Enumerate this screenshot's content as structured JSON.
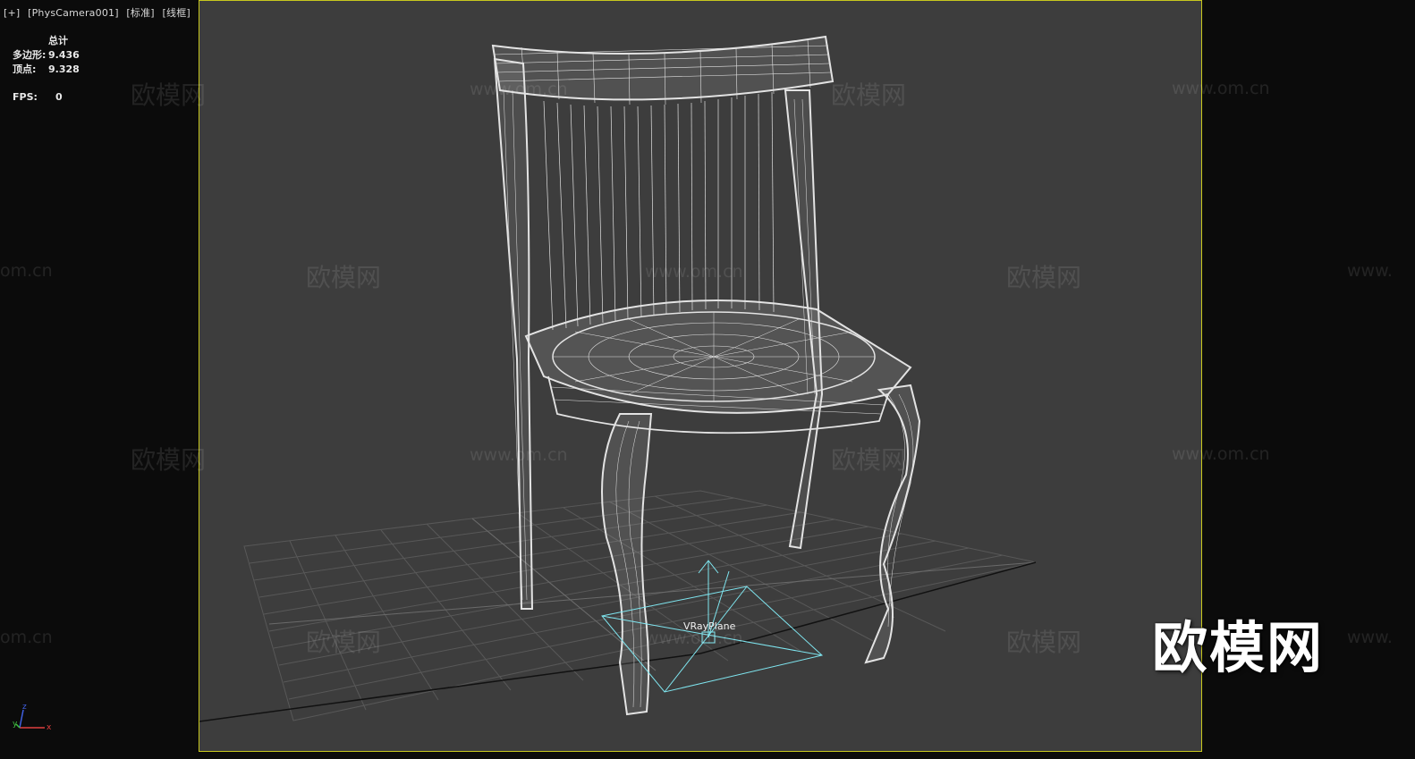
{
  "viewport": {
    "menu": "[+]",
    "camera": "[PhysCamera001]",
    "shading": "[标准]",
    "mode": "[线框]"
  },
  "stats": {
    "header": "总计",
    "polys_label": "多边形:",
    "polys_value": "9.436",
    "verts_label": "顶点:",
    "verts_value": "9.328",
    "fps_label": "FPS:",
    "fps_value": "0"
  },
  "scene": {
    "object_label": "VRayPlane",
    "wire_color": "#e6e6e6",
    "grid_color": "#5a5a5a",
    "gizmo_color": "#7fe6f0",
    "safe_frame_color": "#c8c81e"
  },
  "watermarks": {
    "brand": "欧模网",
    "url": "www.om.cn",
    "url_left": "om.cn",
    "url_right": "www.",
    "logo": "欧模网"
  },
  "axis": {
    "x": "x",
    "y": "y",
    "z": "z"
  }
}
